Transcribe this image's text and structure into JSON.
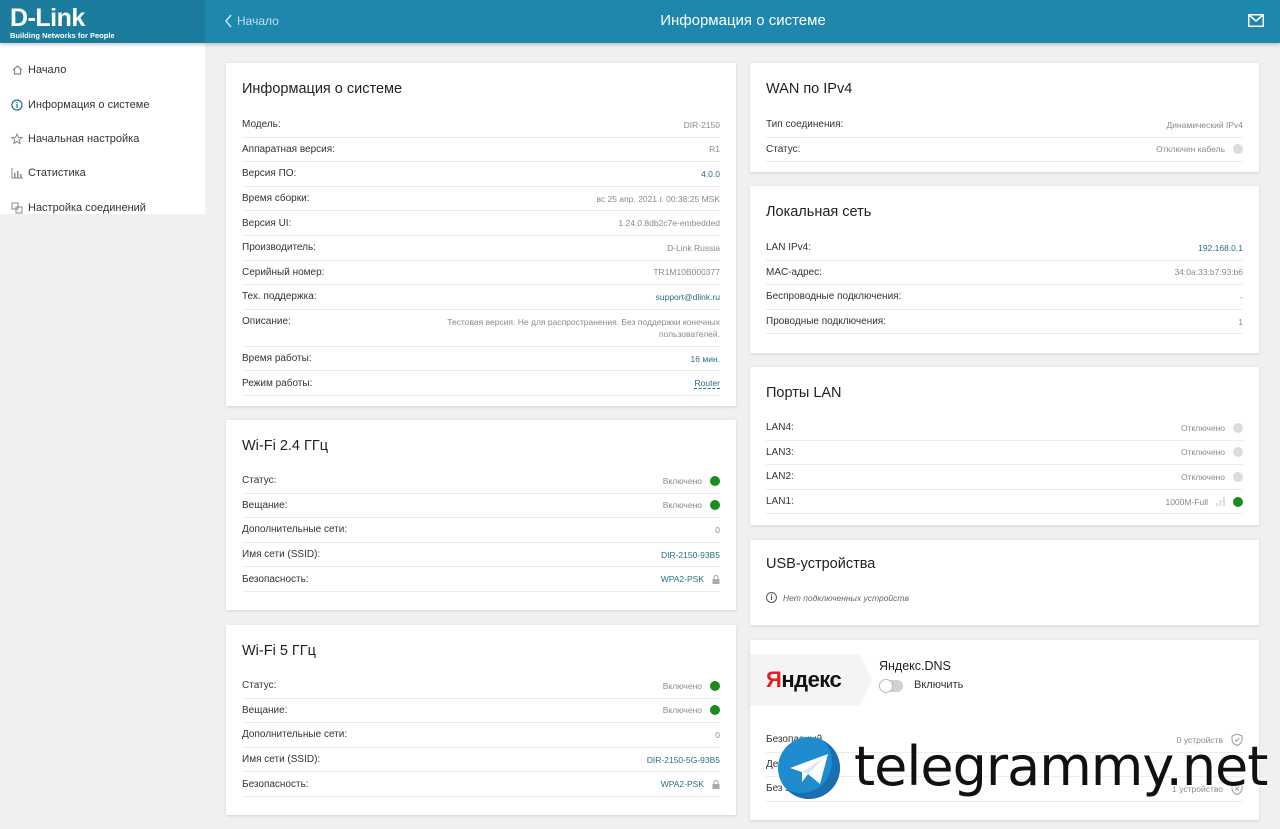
{
  "header": {
    "logo_main": "D-Link",
    "logo_sub": "Building Networks for People",
    "back_label": "Начало",
    "title": "Информация о системе",
    "accent": "#1d87ad"
  },
  "sidebar": {
    "items": [
      {
        "label": "Начало",
        "icon": "home-icon"
      },
      {
        "label": "Информация о системе",
        "icon": "info-icon"
      },
      {
        "label": "Начальная настройка",
        "icon": "star-icon"
      },
      {
        "label": "Статистика",
        "icon": "bar-chart-icon"
      },
      {
        "label": "Настройка соединений",
        "icon": "connections-icon"
      }
    ]
  },
  "sysinfo": {
    "title": "Информация о системе",
    "rows": [
      {
        "label": "Модель:",
        "value": "DIR-2150"
      },
      {
        "label": "Аппаратная версия:",
        "value": "R1"
      },
      {
        "label": "Версия ПО:",
        "value": "4.0.0"
      },
      {
        "label": "Время сборки:",
        "value": "вс 25 апр. 2021 г. 00:38:25 MSK"
      },
      {
        "label": "Версия UI:",
        "value": "1.24.0.8db2c7e-embedded"
      },
      {
        "label": "Производитель:",
        "value": "D-Link Russia"
      },
      {
        "label": "Серийный номер:",
        "value": "TR1M10B000377"
      },
      {
        "label": "Тех. поддержка:",
        "value": "support@dlink.ru"
      },
      {
        "label": "Описание:",
        "value": "Тестовая версия. Не для распространения. Без поддержки конечных пользователей."
      },
      {
        "label": "Время работы:",
        "value": "16 мин."
      },
      {
        "label": "Режим работы:",
        "value": "Router"
      }
    ]
  },
  "wifi24": {
    "title": "Wi-Fi 2.4 ГГц",
    "rows": [
      {
        "label": "Статус:",
        "value": "Включено"
      },
      {
        "label": "Вещание:",
        "value": "Включено"
      },
      {
        "label": "Дополнительные сети:",
        "value": "0"
      },
      {
        "label": "Имя сети (SSID):",
        "value": "DIR-2150-93B5"
      },
      {
        "label": "Безопасность:",
        "value": "WPA2-PSK"
      }
    ]
  },
  "wifi5": {
    "title": "Wi-Fi 5 ГГц",
    "rows": [
      {
        "label": "Статус:",
        "value": "Включено"
      },
      {
        "label": "Вещание:",
        "value": "Включено"
      },
      {
        "label": "Дополнительные сети:",
        "value": "0"
      },
      {
        "label": "Имя сети (SSID):",
        "value": "DIR-2150-5G-93B5"
      },
      {
        "label": "Безопасность:",
        "value": "WPA2-PSK"
      }
    ]
  },
  "wan": {
    "title": "WAN по IPv4",
    "rows": [
      {
        "label": "Тип соединения:",
        "value": "Динамический IPv4"
      },
      {
        "label": "Статус:",
        "value": "Отключен кабель"
      }
    ]
  },
  "lan": {
    "title": "Локальная сеть",
    "rows": [
      {
        "label": "LAN IPv4:",
        "value": "192.168.0.1"
      },
      {
        "label": "MAC-адрес:",
        "value": "34:0a:33:b7:93:b6"
      },
      {
        "label": "Беспроводные подключения:",
        "value": "-"
      },
      {
        "label": "Проводные подключения:",
        "value": "1"
      }
    ]
  },
  "ports": {
    "title": "Порты LAN",
    "rows": [
      {
        "label": "LAN4:",
        "value": "Отключено"
      },
      {
        "label": "LAN3:",
        "value": "Отключено"
      },
      {
        "label": "LAN2:",
        "value": "Отключено"
      },
      {
        "label": "LAN1:",
        "value": "1000M-Full"
      }
    ]
  },
  "usb": {
    "title": "USB-устройства",
    "message": "Нет подключенных устройств"
  },
  "yandex": {
    "logo_red": "Я",
    "logo_rest": "ндекс",
    "title": "Яндекс.DNS",
    "toggle_label": "Включить",
    "rows": [
      {
        "label": "Безопасный",
        "value": "0 устройств"
      },
      {
        "label": "Детский",
        "value": ""
      },
      {
        "label": "Без защиты",
        "value": "1 устройство"
      }
    ]
  },
  "watermark": {
    "text": "telegrammy.net"
  },
  "colors": {
    "status_on": "#1c8c1c",
    "status_off": "#dcdcdc",
    "link": "#2a6e86"
  }
}
